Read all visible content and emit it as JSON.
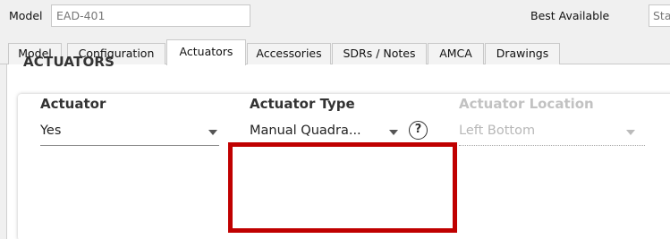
{
  "header": {
    "model_label": "Model",
    "model_value": "EAD-401",
    "best_available_label": "Best Available",
    "best_available_value": "Sta"
  },
  "tabs": [
    {
      "label": "Model",
      "active": false
    },
    {
      "label": "Configuration",
      "active": false
    },
    {
      "label": "Actuators",
      "active": true
    },
    {
      "label": "Accessories",
      "active": false
    },
    {
      "label": "SDRs / Notes",
      "active": false
    },
    {
      "label": "AMCA",
      "active": false
    },
    {
      "label": "Drawings",
      "active": false
    }
  ],
  "actuators": {
    "section_title": "ACTUATORS",
    "actuator": {
      "label": "Actuator",
      "value": "Yes"
    },
    "actuator_type": {
      "label": "Actuator Type",
      "value": "Manual Quadra...",
      "help": "?"
    },
    "actuator_location": {
      "label": "Actuator Location",
      "value": "Left Bottom",
      "disabled": true
    }
  },
  "colors": {
    "highlight": "#c00000",
    "background": "#f0f0f0",
    "disabled_text": "#c2c2c2"
  }
}
